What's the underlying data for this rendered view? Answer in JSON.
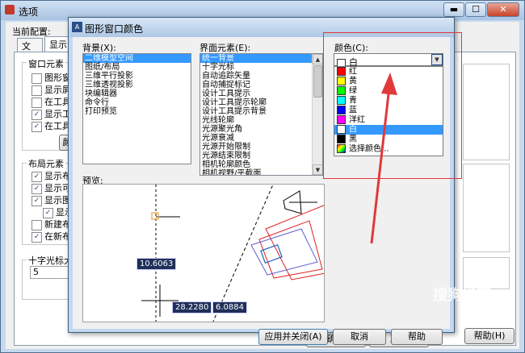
{
  "back_window": {
    "title": "选项",
    "current_profile_label": "当前配置:",
    "tabs": [
      "文件",
      "显示"
    ],
    "window_elements_group": "窗口元素",
    "window_elements": [
      {
        "label": "图形窗口",
        "checked": false
      },
      {
        "label": "显示屏幕",
        "checked": false
      },
      {
        "label": "在工具栏",
        "checked": false
      },
      {
        "label": "显示工具",
        "checked": true
      },
      {
        "label": "在工具栏",
        "checked": true
      }
    ],
    "colors_button_partial": "颜",
    "layout_elements_group": "布局元素",
    "layout_elements": [
      {
        "label": "显示布局",
        "checked": true
      },
      {
        "label": "显示可打",
        "checked": true
      },
      {
        "label": "显示图纸",
        "checked": true
      },
      {
        "label": "显示",
        "checked": true
      },
      {
        "label": "新建布局",
        "checked": false
      },
      {
        "label": "在新布局",
        "checked": true
      }
    ],
    "crosshair_group": "十字光标大",
    "crosshair_value": "5",
    "ok_partial": "确定",
    "cancel_partial": "取消",
    "help_button": "帮助(H)",
    "title_controls": [
      "▬",
      "☐",
      "✕"
    ]
  },
  "dialog": {
    "title": "图形窗口颜色",
    "context_label": "背景(X):",
    "context_items": [
      "二维模型空间",
      "图纸/布局",
      "三维平行投影",
      "三维透视投影",
      "块编辑器",
      "命令行",
      "打印预览"
    ],
    "context_selected_index": 0,
    "interface_label": "界面元素(E):",
    "interface_items": [
      "统一背景",
      "十字光标",
      "自动追踪矢量",
      "自动捕捉标记",
      "设计工具提示",
      "设计工具提示轮廓",
      "设计工具提示背景",
      "光线轮廓",
      "光源聚光角",
      "光源衰减",
      "光源开始限制",
      "光源结束限制",
      "相机轮廓颜色",
      "相机视野/平截面"
    ],
    "interface_selected_index": 0,
    "color_label": "颜色(C):",
    "color_current": "白",
    "color_options": [
      {
        "label": "红",
        "color": "#ff0000"
      },
      {
        "label": "黄",
        "color": "#ffff00"
      },
      {
        "label": "绿",
        "color": "#00ff00"
      },
      {
        "label": "青",
        "color": "#00ffff"
      },
      {
        "label": "蓝",
        "color": "#0000ff"
      },
      {
        "label": "洋红",
        "color": "#ff00ff"
      },
      {
        "label": "白",
        "color": "#ffffff"
      },
      {
        "label": "黑",
        "color": "#000000"
      },
      {
        "label": "选择颜色...",
        "color": "multi"
      }
    ],
    "color_selected_index": 6,
    "preview_label": "预览:",
    "coord_1": "10.6063",
    "coord_2": "28.2280",
    "coord_3": "6.0884",
    "apply_close_button": "应用并关闭(A)",
    "cancel_button": "取消",
    "help_button": "帮助"
  },
  "annotation": {
    "highlight_color": "#e0393a"
  },
  "watermark": "搜狗指南"
}
